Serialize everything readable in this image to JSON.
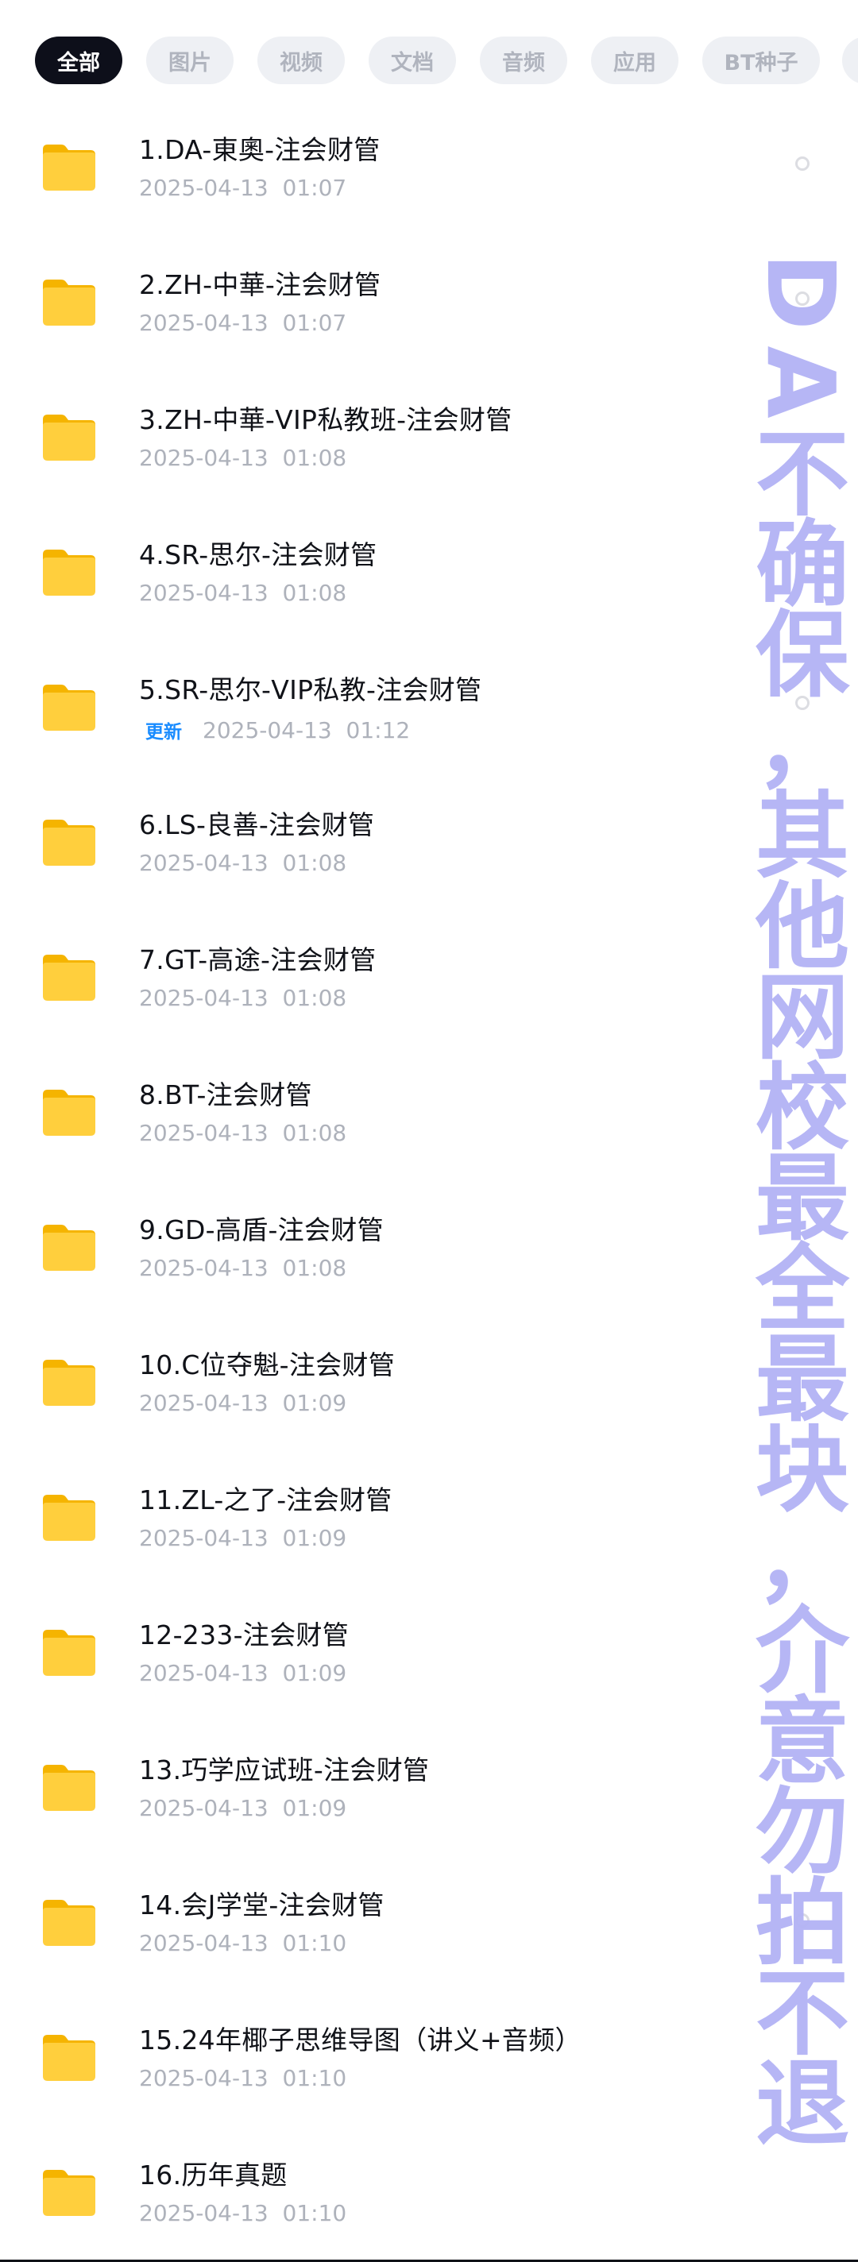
{
  "filter_tabs": [
    {
      "label": "全部",
      "active": true
    },
    {
      "label": "图片",
      "active": false
    },
    {
      "label": "视频",
      "active": false
    },
    {
      "label": "文档",
      "active": false
    },
    {
      "label": "音频",
      "active": false
    },
    {
      "label": "应用",
      "active": false
    },
    {
      "label": "BT种子",
      "active": false
    }
  ],
  "files": [
    {
      "name": "1.DA-東奧-注会财管",
      "date": "2025-04-13",
      "time": "01:07",
      "badge": ""
    },
    {
      "name": "2.ZH-中華-注会财管",
      "date": "2025-04-13",
      "time": "01:07",
      "badge": ""
    },
    {
      "name": "3.ZH-中華-VIP私教班-注会财管",
      "date": "2025-04-13",
      "time": "01:08",
      "badge": ""
    },
    {
      "name": "4.SR-思尔-注会财管",
      "date": "2025-04-13",
      "time": "01:08",
      "badge": ""
    },
    {
      "name": "5.SR-思尔-VIP私教-注会财管",
      "date": "2025-04-13",
      "time": "01:12",
      "badge": "更新"
    },
    {
      "name": "6.LS-良善-注会财管",
      "date": "2025-04-13",
      "time": "01:08",
      "badge": ""
    },
    {
      "name": "7.GT-高途-注会财管",
      "date": "2025-04-13",
      "time": "01:08",
      "badge": ""
    },
    {
      "name": "8.BT-注会财管",
      "date": "2025-04-13",
      "time": "01:08",
      "badge": ""
    },
    {
      "name": "9.GD-高盾-注会财管",
      "date": "2025-04-13",
      "time": "01:08",
      "badge": ""
    },
    {
      "name": "10.C位夺魁-注会财管",
      "date": "2025-04-13",
      "time": "01:09",
      "badge": ""
    },
    {
      "name": "11.ZL-之了-注会财管",
      "date": "2025-04-13",
      "time": "01:09",
      "badge": ""
    },
    {
      "name": "12-233-注会财管",
      "date": "2025-04-13",
      "time": "01:09",
      "badge": ""
    },
    {
      "name": "13.巧学应试班-注会财管",
      "date": "2025-04-13",
      "time": "01:09",
      "badge": ""
    },
    {
      "name": "14.会J学堂-注会财管",
      "date": "2025-04-13",
      "time": "01:10",
      "badge": ""
    },
    {
      "name": "15.24年椰子思维导图（讲义+音频）",
      "date": "2025-04-13",
      "time": "01:10",
      "badge": ""
    },
    {
      "name": "16.历年真题",
      "date": "2025-04-13",
      "time": "01:10",
      "badge": ""
    }
  ],
  "watermark": {
    "text": "DA不确保，其他网校最全最块，介意勿拍不退",
    "color": "#b3b3f5"
  },
  "colors": {
    "active_tab_bg": "#0d0f1a",
    "tab_bg": "#eef0f4",
    "folder_yellow": "#ffcf3d",
    "badge_blue": "#1a8cff"
  },
  "icons": {
    "folder": "folder-icon"
  }
}
